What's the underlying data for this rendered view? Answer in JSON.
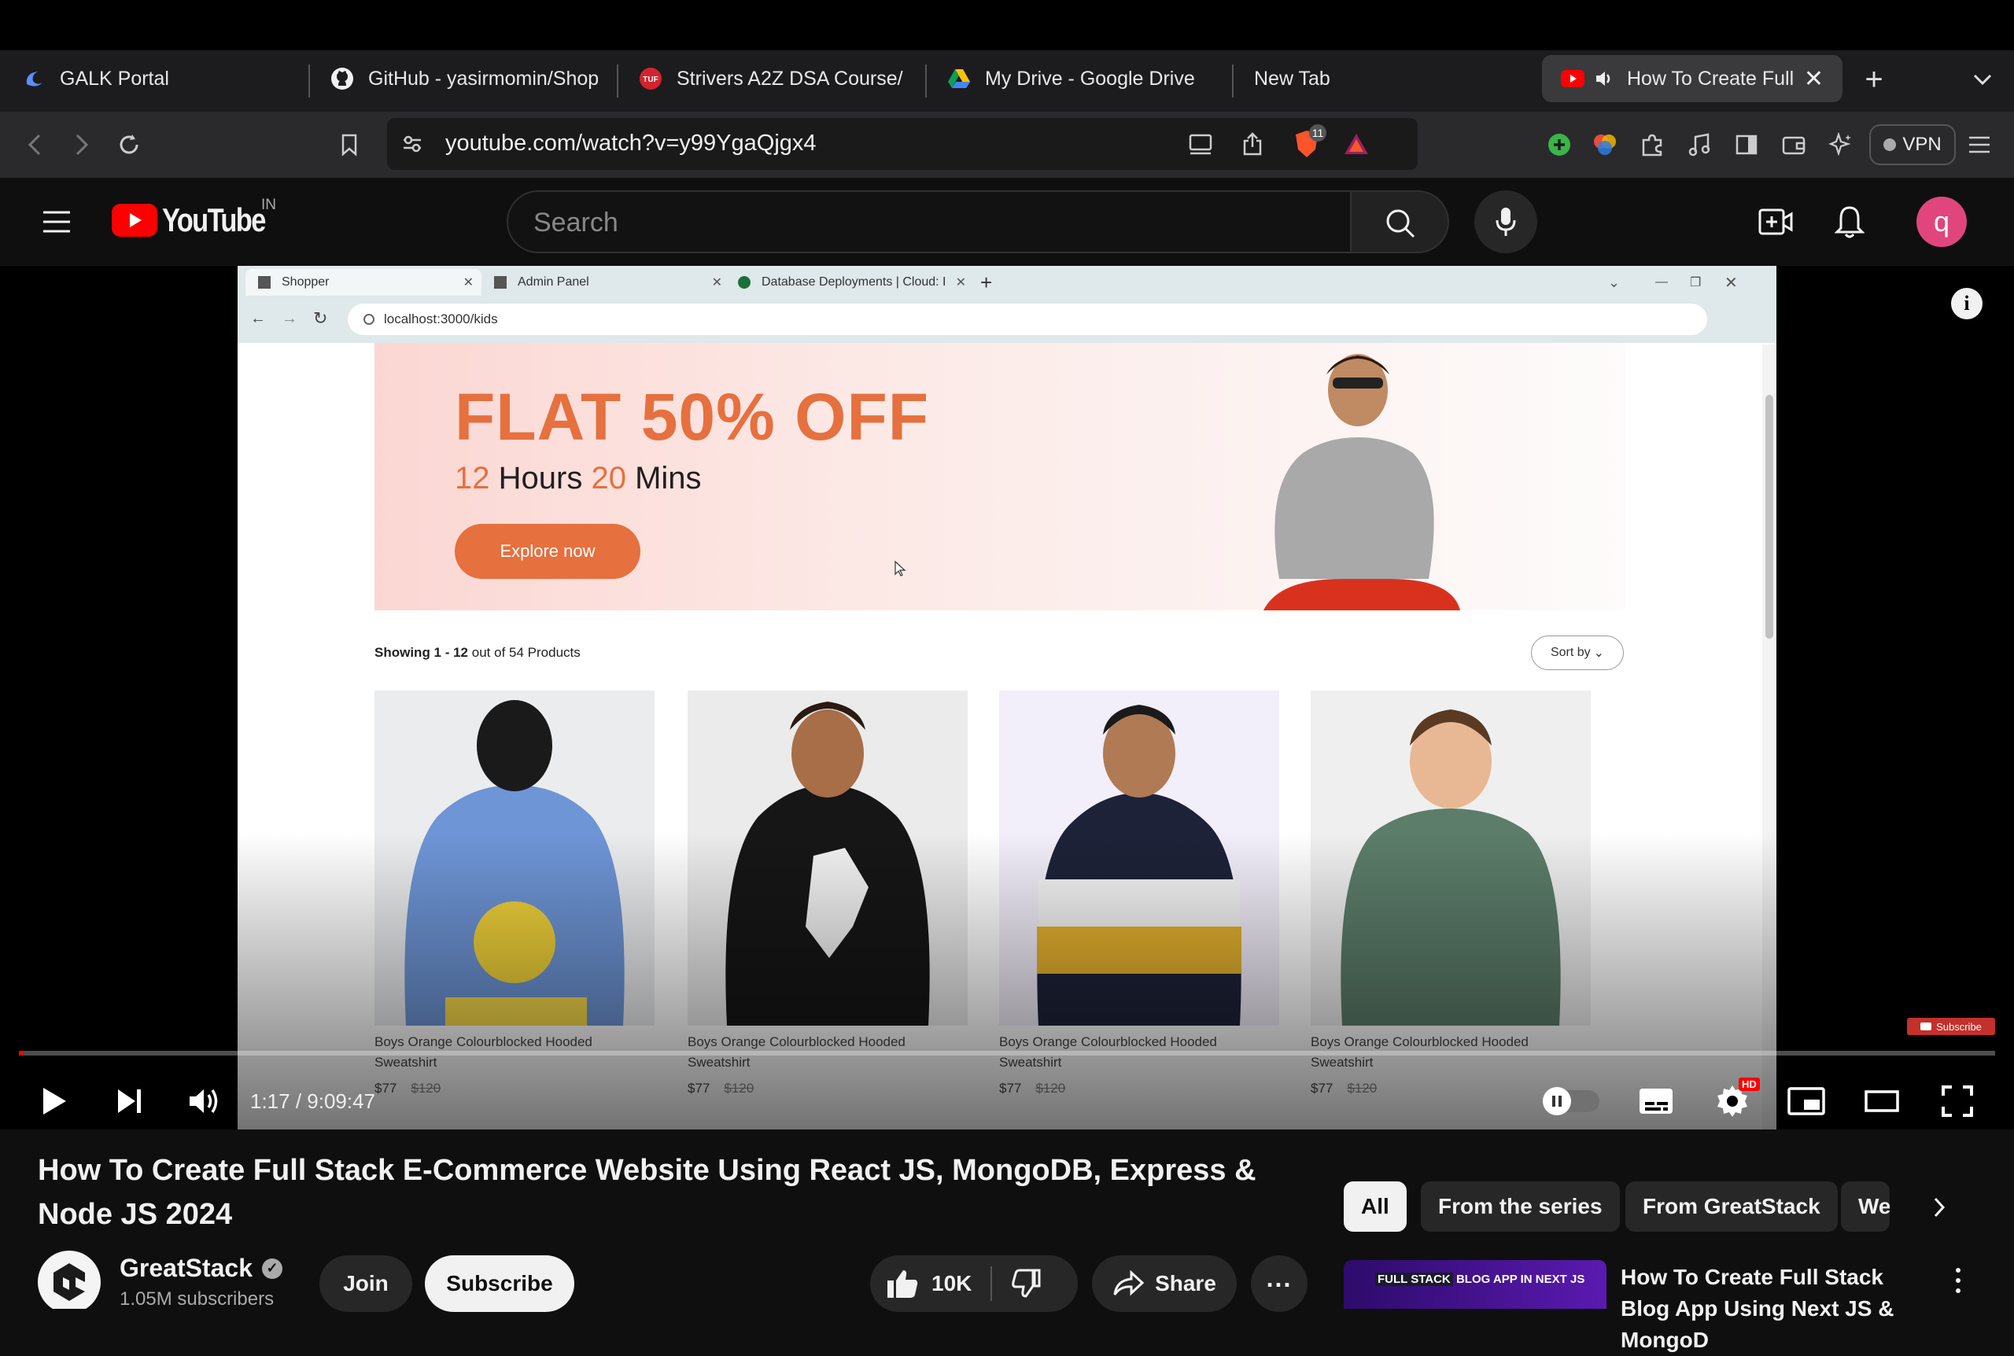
{
  "browser": {
    "tabs": [
      {
        "label": "GALK Portal",
        "icon": "galk-icon"
      },
      {
        "label": "GitHub - yasirmomin/Shop",
        "icon": "github-icon"
      },
      {
        "label": "Strivers A2Z DSA Course/",
        "icon": "tuf-icon"
      },
      {
        "label": "My Drive - Google Drive",
        "icon": "google-drive-icon"
      },
      {
        "label": "New Tab",
        "icon": ""
      },
      {
        "label": "How To Create Full",
        "icon": "youtube-icon"
      }
    ],
    "url": "youtube.com/watch?v=y99YgaQjgx4",
    "shield_count": "11",
    "vpn_label": "VPN"
  },
  "youtube": {
    "logo_text": "YouTube",
    "region": "IN",
    "search_placeholder": "Search",
    "avatar_letter": "q"
  },
  "video_content": {
    "tabs": [
      "Shopper",
      "Admin Panel",
      "Database Deployments | Cloud: I"
    ],
    "url": "localhost:3000/kids",
    "banner_title": "FLAT 50% OFF",
    "banner_hours_num": "12",
    "banner_hours_label": "Hours",
    "banner_mins_num": "20",
    "banner_mins_label": "Mins",
    "explore_label": "Explore now",
    "showing_bold": "Showing 1 - 12",
    "showing_rest": "out of 54 Products",
    "sort_label": "Sort by",
    "products": [
      {
        "name": "Boys Orange Colourblocked Hooded Sweatshirt",
        "price": "$77",
        "old_price": "$120",
        "color": "#6e95d6"
      },
      {
        "name": "Boys Orange Colourblocked Hooded Sweatshirt",
        "price": "$77",
        "old_price": "$120",
        "color": "#161616"
      },
      {
        "name": "Boys Orange Colourblocked Hooded Sweatshirt",
        "price": "$77",
        "old_price": "$120",
        "color": "#e8b832"
      },
      {
        "name": "Boys Orange Colourblocked Hooded Sweatshirt",
        "price": "$77",
        "old_price": "$120",
        "color": "#5c7d6a"
      }
    ]
  },
  "player": {
    "time": "1:17 / 9:09:47",
    "subscribe_watermark": "Subscribe",
    "hd_badge": "HD",
    "progress_fraction": 0.0024
  },
  "video_info": {
    "title": "How To Create Full Stack E-Commerce Website Using React JS, MongoDB, Express & Node JS 2024",
    "channel": "GreatStack",
    "subscribers": "1.05M subscribers",
    "join_label": "Join",
    "subscribe_label": "Subscribe",
    "likes": "10K",
    "share_label": "Share"
  },
  "chips": [
    "All",
    "From the series",
    "From GreatStack",
    "We"
  ],
  "recommendation": {
    "title": "How To Create Full Stack Blog App Using Next JS & MongoD",
    "thumb_text": "FULL STACK",
    "thumb_text2": "BLOG APP IN NEXT JS"
  }
}
